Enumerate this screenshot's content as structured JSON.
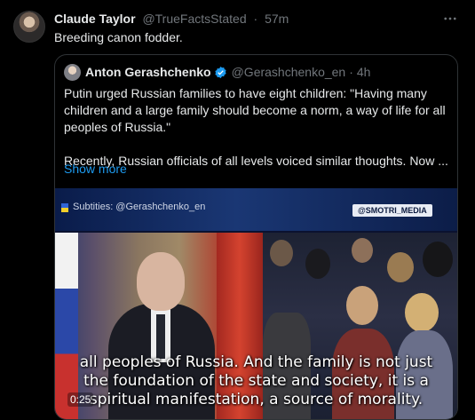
{
  "tweet": {
    "author_name": "Claude Taylor",
    "author_handle": "@TrueFactsStated",
    "separator": "·",
    "time": "57m",
    "text": "Breeding canon fodder."
  },
  "quote": {
    "author_name": "Anton Gerashchenko",
    "author_handle": "@Gerashchenko_en",
    "separator": "·",
    "time": "4h",
    "paragraph1": "Putin urged Russian families to have eight children: \"Having many children and a large family should become a norm, a way of life for all peoples of Russia.\"",
    "paragraph2": "Recently, Russian officials of all levels voiced similar thoughts. Now ...",
    "show_more": "Show more"
  },
  "video": {
    "subtitles_credit": "Subtities: @Gerashchenko_en",
    "channel_tag": "@SMOTRI_MEDIA",
    "caption_line1": "all peoples of Russia. And the family is not just",
    "caption_line2": "the foundation of the state and society, it is a",
    "caption_line3": "spiritual manifestation, a source of morality.",
    "timestamp": "0:25"
  },
  "colors": {
    "link": "#1d9bf0",
    "muted": "#71767b",
    "verified": "#1d9bf0"
  },
  "icons": {
    "more": "more-options-icon",
    "verified": "verified-badge-icon",
    "flag": "ukraine-flag-icon"
  }
}
